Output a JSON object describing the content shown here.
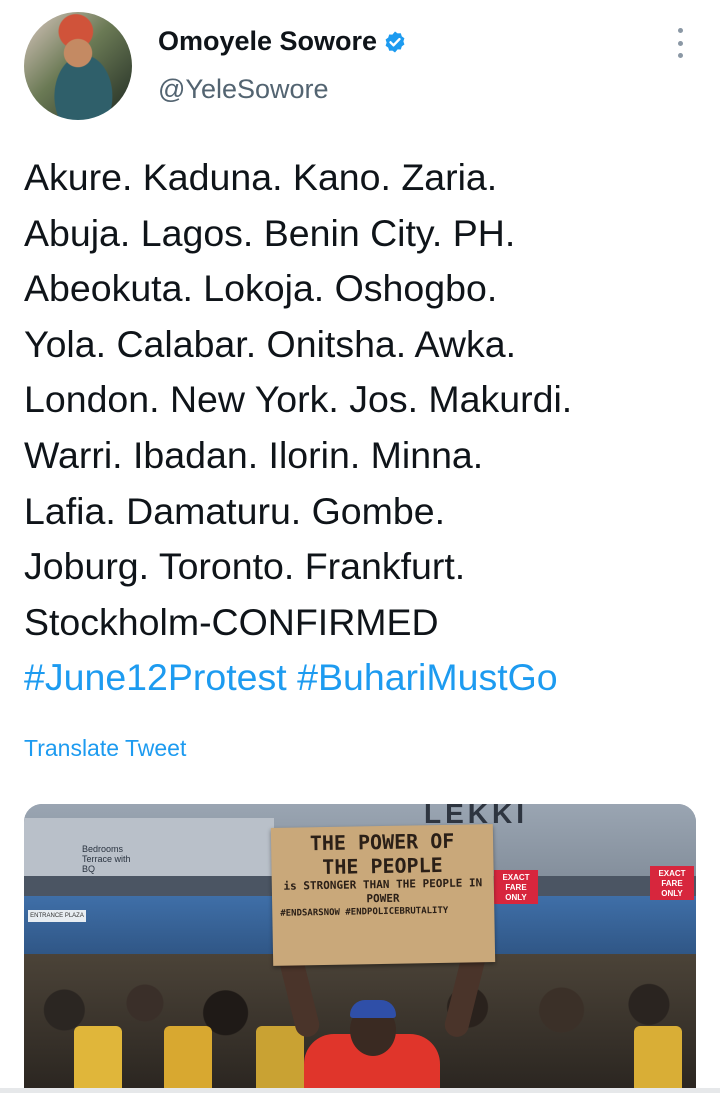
{
  "user": {
    "name": "Omoyele Sowore",
    "handle": "@YeleSowore",
    "verified": true,
    "avatar_icon": "profile-photo"
  },
  "tweet": {
    "lines": [
      "Akure. Kaduna. Kano. Zaria.",
      "Abuja. Lagos. Benin City. PH.",
      "Abeokuta. Lokoja. Oshogbo.",
      "Yola. Calabar. Onitsha. Awka.",
      "London. New York. Jos. Makurdi.",
      "Warri. Ibadan. Ilorin. Minna.",
      "Lafia. Damaturu. Gombe.",
      "Joburg. Toronto. Frankfurt.",
      "Stockholm-CONFIRMED"
    ],
    "hashtags": [
      "#June12Protest",
      "#BuhariMustGo"
    ],
    "translate_label": "Translate Tweet"
  },
  "photo": {
    "sign_lines": [
      "THE POWER OF",
      "THE PEOPLE",
      "is STRONGER THAN THE PEOPLE IN POWER",
      "#ENDSARSNOW #ENDPOLICEBRUTALITY"
    ],
    "building_sign": "LEKKI",
    "banner_text": "Bedrooms Terrace with BQ",
    "plaza_sign": "ENTRANCE PLAZA",
    "fare_signs": [
      "EXACT FARE ONLY",
      "EXACT FARE ONLY"
    ]
  },
  "colors": {
    "link": "#1d9bf0",
    "text": "#0f1419",
    "secondary": "#536471",
    "verified": "#1d9bf0"
  }
}
